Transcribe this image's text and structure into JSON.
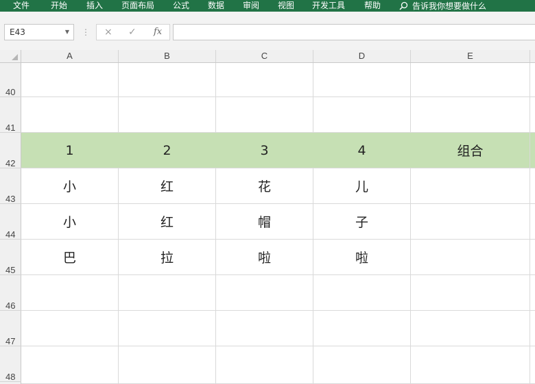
{
  "ribbon": {
    "tabs": [
      "文件",
      "开始",
      "插入",
      "页面布局",
      "公式",
      "数据",
      "审阅",
      "视图",
      "开发工具",
      "帮助"
    ],
    "search_label": "告诉我你想要做什么",
    "background": "#217346"
  },
  "formula_bar": {
    "name_box": "E43",
    "cancel_icon": "×",
    "enter_icon": "✓",
    "fx_label": "fx",
    "formula_value": ""
  },
  "columns": [
    "A",
    "B",
    "C",
    "D",
    "E"
  ],
  "rows": [
    {
      "header": "40",
      "cells": [
        "",
        "",
        "",
        "",
        ""
      ],
      "highlight": false
    },
    {
      "header": "41",
      "cells": [
        "",
        "",
        "",
        "",
        ""
      ],
      "highlight": false
    },
    {
      "header": "42",
      "cells": [
        "1",
        "2",
        "3",
        "4",
        "组合"
      ],
      "highlight": true
    },
    {
      "header": "43",
      "cells": [
        "小",
        "红",
        "花",
        "儿",
        ""
      ],
      "highlight": false
    },
    {
      "header": "44",
      "cells": [
        "小",
        "红",
        "帽",
        "子",
        ""
      ],
      "highlight": false
    },
    {
      "header": "45",
      "cells": [
        "巴",
        "拉",
        "啦",
        "啦",
        ""
      ],
      "highlight": false
    },
    {
      "header": "46",
      "cells": [
        "",
        "",
        "",
        "",
        ""
      ],
      "highlight": false
    },
    {
      "header": "47",
      "cells": [
        "",
        "",
        "",
        "",
        ""
      ],
      "highlight": false
    },
    {
      "header": "48",
      "cells": [
        "",
        "",
        "",
        "",
        ""
      ],
      "highlight": false
    }
  ],
  "highlight_color": "#c6e0b4"
}
